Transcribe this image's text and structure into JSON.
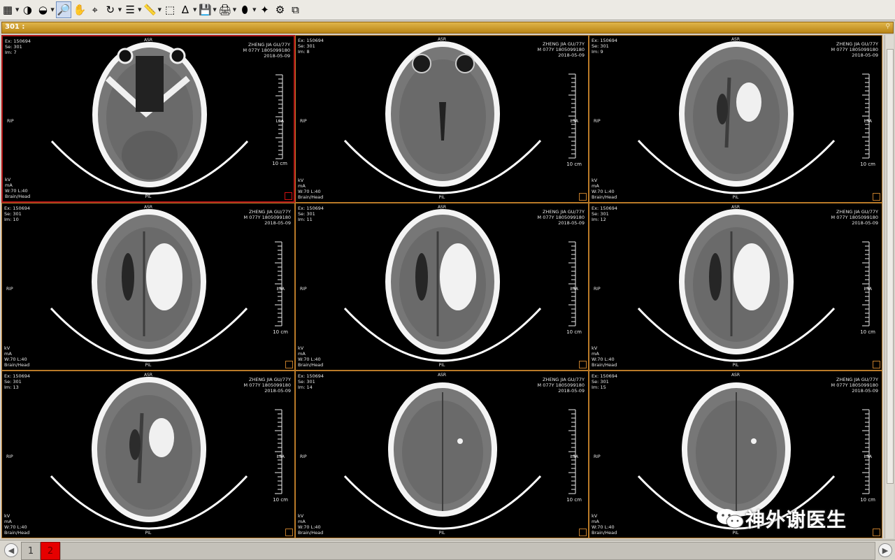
{
  "toolbar": {
    "tools": [
      {
        "name": "layout-grid-tool",
        "glyph": "▦",
        "dropdown": true,
        "active": false
      },
      {
        "name": "window-level-tool",
        "glyph": "◑",
        "dropdown": false,
        "active": false
      },
      {
        "name": "invert-tool",
        "glyph": "◒",
        "dropdown": true,
        "active": false
      },
      {
        "name": "zoom-tool",
        "glyph": "🔎",
        "dropdown": false,
        "active": true
      },
      {
        "name": "pan-tool",
        "glyph": "✋",
        "dropdown": false,
        "active": false
      },
      {
        "name": "magnify-tool",
        "glyph": "⌖",
        "dropdown": false,
        "active": false
      },
      {
        "name": "rotate-tool",
        "glyph": "↻",
        "dropdown": true,
        "active": false
      },
      {
        "name": "stack-tool",
        "glyph": "☰",
        "dropdown": true,
        "active": false
      },
      {
        "name": "ruler-tool",
        "glyph": "📏",
        "dropdown": true,
        "active": false
      },
      {
        "name": "roi-tool",
        "glyph": "⬚",
        "dropdown": false,
        "active": false
      },
      {
        "name": "angle-tool",
        "glyph": "∆",
        "dropdown": true,
        "active": false
      },
      {
        "name": "save-tool",
        "glyph": "💾",
        "dropdown": true,
        "active": false
      },
      {
        "name": "print-tool",
        "glyph": "🖨",
        "dropdown": true,
        "active": false
      },
      {
        "name": "brain-3d-tool",
        "glyph": "⬮",
        "dropdown": true,
        "active": false
      },
      {
        "name": "reset-tool",
        "glyph": "✦",
        "dropdown": false,
        "active": false
      },
      {
        "name": "sync-tool",
        "glyph": "⚙",
        "dropdown": false,
        "active": false
      },
      {
        "name": "fullscreen-tool",
        "glyph": "⧉",
        "dropdown": false,
        "active": false
      }
    ]
  },
  "series_bar": {
    "label": "301 :"
  },
  "viewports": [
    {
      "ex": "Ex: 150694",
      "se": "Se: 301",
      "im": "Im: 7",
      "patient": "ZHENG JIA GU/77Y",
      "id": "M 077Y 1805099180",
      "date": "2018-05-09",
      "kv": "kV",
      "ma": "mA",
      "wl": "W:70 L:40",
      "proto": "Brain/Head",
      "top": "ASR",
      "bottom": "PIL",
      "left": "RIP",
      "right": "LSA",
      "scale": "10 cm",
      "selected": true,
      "variant": "base"
    },
    {
      "ex": "Ex: 150694",
      "se": "Se: 301",
      "im": "Im: 8",
      "patient": "ZHENG JIA GU/77Y",
      "id": "M 077Y 1805099180",
      "date": "2018-05-09",
      "kv": "kV",
      "ma": "mA",
      "wl": "W:70 L:40",
      "proto": "Brain/Head",
      "top": "ASR",
      "bottom": "PIL",
      "left": "RIP",
      "right": "LSA",
      "scale": "10 cm",
      "selected": false,
      "variant": "orbit"
    },
    {
      "ex": "Ex: 150694",
      "se": "Se: 301",
      "im": "Im: 9",
      "patient": "ZHENG JIA GU/77Y",
      "id": "M 077Y 1805099180",
      "date": "2018-05-09",
      "kv": "kV",
      "ma": "mA",
      "wl": "W:70 L:40",
      "proto": "Brain/Head",
      "top": "ASR",
      "bottom": "PIL",
      "left": "RIP",
      "right": "LSA",
      "scale": "10 cm",
      "selected": false,
      "variant": "small-bleed"
    },
    {
      "ex": "Ex: 150694",
      "se": "Se: 301",
      "im": "Im: 10",
      "patient": "ZHENG JIA GU/77Y",
      "id": "M 077Y 1805099180",
      "date": "2018-05-09",
      "kv": "kV",
      "ma": "mA",
      "wl": "W:70 L:40",
      "proto": "Brain/Head",
      "top": "ASR",
      "bottom": "PIL",
      "left": "RIP",
      "right": "LSA",
      "scale": "10 cm",
      "selected": false,
      "variant": "bleed"
    },
    {
      "ex": "Ex: 150694",
      "se": "Se: 301",
      "im": "Im: 11",
      "patient": "ZHENG JIA GU/77Y",
      "id": "M 077Y 1805099180",
      "date": "2018-05-09",
      "kv": "kV",
      "ma": "mA",
      "wl": "W:70 L:40",
      "proto": "Brain/Head",
      "top": "ASR",
      "bottom": "PIL",
      "left": "RIP",
      "right": "LSA",
      "scale": "10 cm",
      "selected": false,
      "variant": "bleed"
    },
    {
      "ex": "Ex: 150694",
      "se": "Se: 301",
      "im": "Im: 12",
      "patient": "ZHENG JIA GU/77Y",
      "id": "M 077Y 1805099180",
      "date": "2018-05-09",
      "kv": "kV",
      "ma": "mA",
      "wl": "W:70 L:40",
      "proto": "Brain/Head",
      "top": "ASR",
      "bottom": "PIL",
      "left": "RIP",
      "right": "LSA",
      "scale": "10 cm",
      "selected": false,
      "variant": "bleed"
    },
    {
      "ex": "Ex: 150694",
      "se": "Se: 301",
      "im": "Im: 13",
      "patient": "ZHENG JIA GU/77Y",
      "id": "M 077Y 1805099180",
      "date": "2018-05-09",
      "kv": "kV",
      "ma": "mA",
      "wl": "W:70 L:40",
      "proto": "Brain/Head",
      "top": "ASR",
      "bottom": "PIL",
      "left": "RIP",
      "right": "LSA",
      "scale": "10 cm",
      "selected": false,
      "variant": "small-bleed"
    },
    {
      "ex": "Ex: 150694",
      "se": "Se: 301",
      "im": "Im: 14",
      "patient": "ZHENG JIA GU/77Y",
      "id": "M 077Y 1805099180",
      "date": "2018-05-09",
      "kv": "kV",
      "ma": "mA",
      "wl": "W:70 L:40",
      "proto": "Brain/Head",
      "top": "ASR",
      "bottom": "PIL",
      "left": "RIP",
      "right": "LSA",
      "scale": "10 cm",
      "selected": false,
      "variant": "vertex"
    },
    {
      "ex": "Ex: 150694",
      "se": "Se: 301",
      "im": "Im: 15",
      "patient": "ZHENG JIA GU/77Y",
      "id": "M 077Y 1805099180",
      "date": "2018-05-09",
      "kv": "kV",
      "ma": "mA",
      "wl": "W:70 L:40",
      "proto": "Brain/Head",
      "top": "ASR",
      "bottom": "PIL",
      "left": "RIP",
      "right": "LSA",
      "scale": "10 cm",
      "selected": false,
      "variant": "vertex"
    }
  ],
  "pager": {
    "pages": [
      "1",
      "2"
    ],
    "current": "2"
  },
  "watermark": {
    "text": "神外谢医生"
  }
}
